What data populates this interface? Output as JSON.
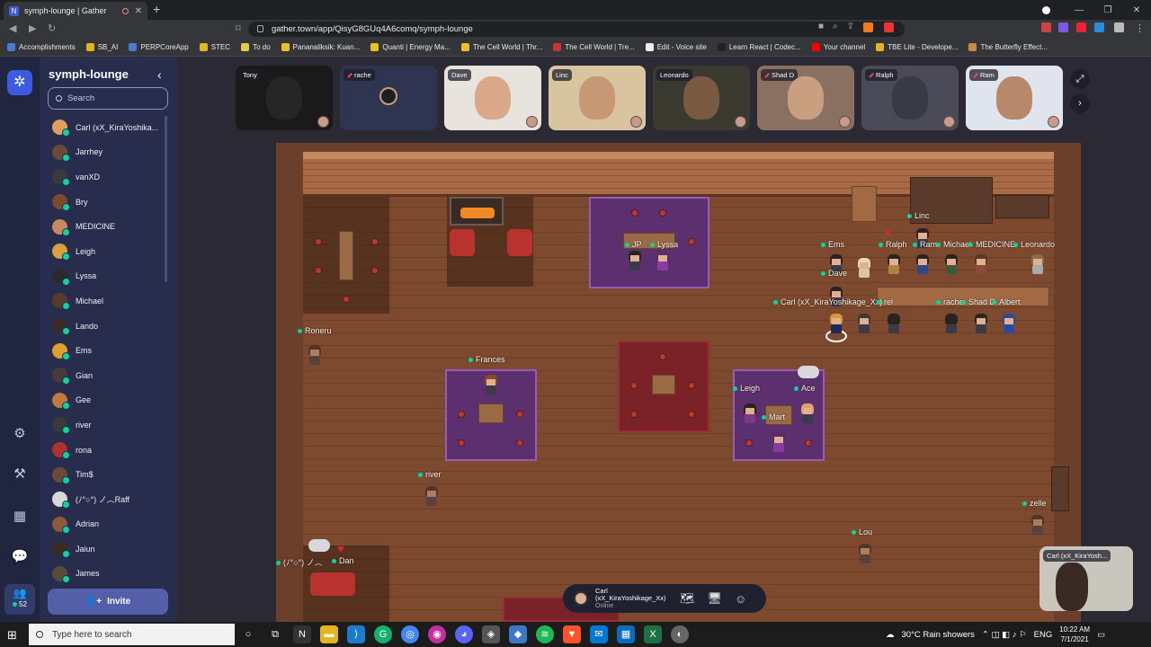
{
  "browser": {
    "tab_title": "symph-lounge | Gather",
    "url": "gather.town/app/QisyG8GUq4A6comq/symph-lounge",
    "bookmarks": [
      "Accomplishments",
      "SB_AI",
      "PERPCoreApp",
      "STEC",
      "To do",
      "Pananaliksik: Kuan...",
      "Quanti | Energy Ma...",
      "The Cell World | Thr...",
      "The Cell World | Tre...",
      "Edit - Voice site",
      "Learn React | Codec...",
      "Your channel",
      "TBE Lite - Develope...",
      "The Butterfly Effect..."
    ]
  },
  "sidebar": {
    "space_name": "symph-lounge",
    "search_placeholder": "Search",
    "users": [
      "Carl (xX_KiraYoshika...",
      "Jarrhey",
      "vanXD",
      "Bry",
      "MEDICINE",
      "Leigh",
      "Lyssa",
      "Michael",
      "Lando",
      "Ems",
      "Gian",
      "Gee",
      "river",
      "rona",
      "Tim$",
      "(ﾉ°○°) ノ︵Raff",
      "Adrian",
      "Jaiun",
      "James"
    ],
    "invite_label": "Invite",
    "online_count": "52"
  },
  "video_tiles": [
    "Tony",
    "rache",
    "Dave",
    "Linc",
    "Leonardo",
    "Shad D",
    "Ralph",
    "Ram"
  ],
  "map_labels": {
    "jp": "JP",
    "lyssa": "Lyssa",
    "linc": "Linc",
    "ems": "Ems",
    "ralph": "Ralph",
    "ram": "Ram",
    "michael": "Michael",
    "medicine": "MEDICINE",
    "leonardo": "Leonardo",
    "dave": "Dave",
    "carl": "Carl (xX_KiraYoshikage_Xx)",
    "rel": "rel",
    "rache": "rache",
    "shad": "Shad D",
    "albert": "Albert",
    "roneru": "Roneru",
    "frances": "Frances",
    "leigh": "Leigh",
    "ace": "Ace",
    "mart": "Mart",
    "river": "river",
    "zelle": "zelle",
    "lou": "Lou",
    "raff": "(ﾉ°○°) ノ︵",
    "dan": "Dan"
  },
  "bottom_bar": {
    "name": "Carl (xX_KiraYoshikage_Xx)",
    "status": "Online"
  },
  "self_video_label": "Carl (xX_KiraYosh...",
  "taskbar": {
    "search_placeholder": "Type here to search",
    "weather": "30°C  Rain showers",
    "lang": "ENG",
    "time": "10:22 AM",
    "date": "7/1/2021"
  },
  "colors": {
    "accent": "#3c5be0",
    "online": "#06d6a0",
    "panel": "#282d4e"
  }
}
